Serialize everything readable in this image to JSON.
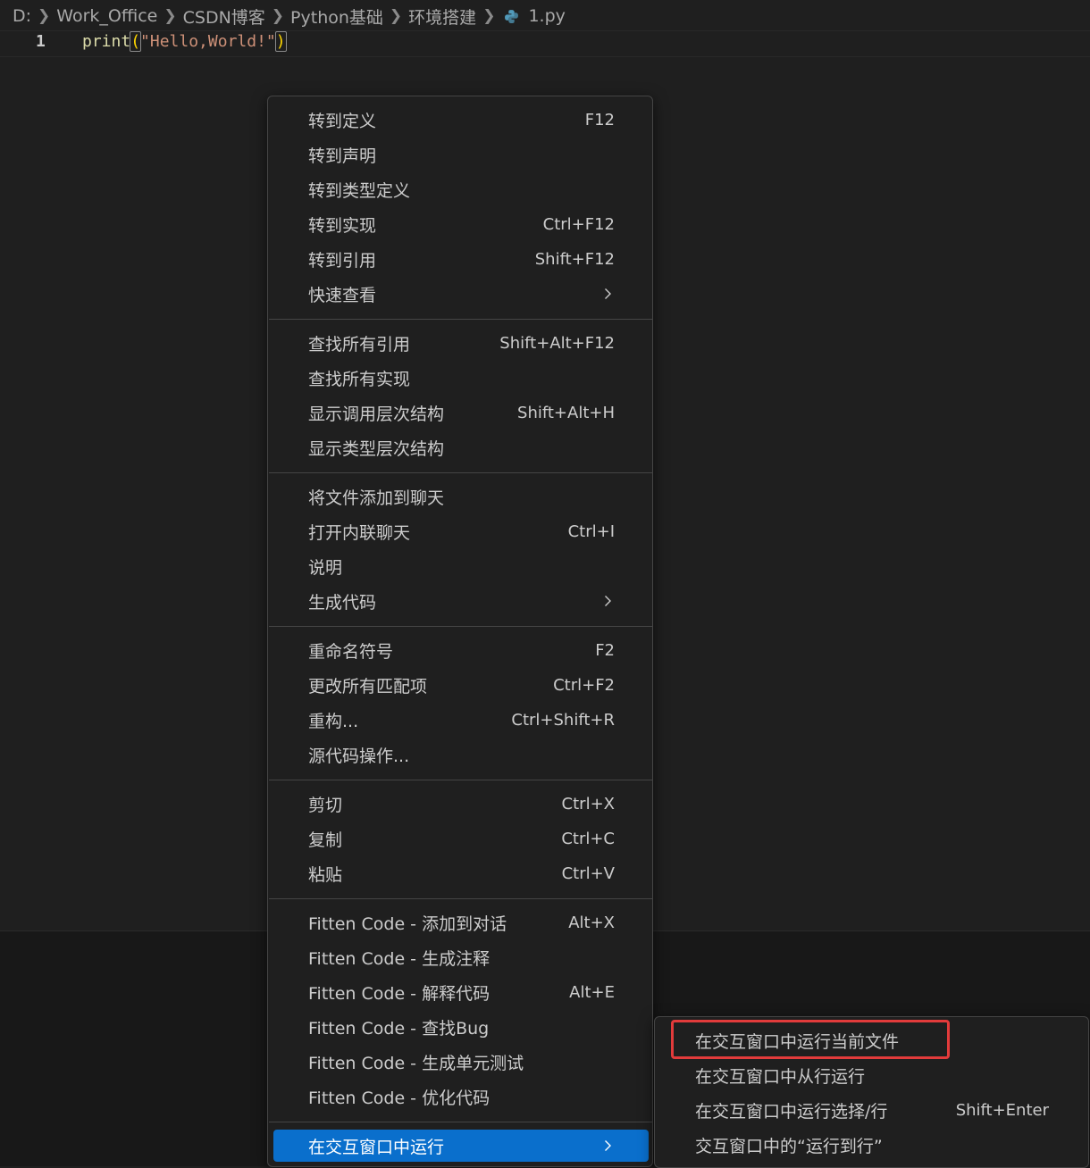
{
  "breadcrumb": {
    "segments": [
      "D:",
      "Work_Office",
      "CSDN博客",
      "Python基础",
      "环境搭建"
    ],
    "file": "1.py",
    "file_icon": "python-icon"
  },
  "editor": {
    "line_number": "1",
    "code": {
      "fn": "print",
      "open": "(",
      "str": "\"Hello,World!\"",
      "close": ")"
    }
  },
  "context_menu": {
    "groups": [
      [
        {
          "label": "转到定义",
          "shortcut": "F12"
        },
        {
          "label": "转到声明",
          "shortcut": ""
        },
        {
          "label": "转到类型定义",
          "shortcut": ""
        },
        {
          "label": "转到实现",
          "shortcut": "Ctrl+F12"
        },
        {
          "label": "转到引用",
          "shortcut": "Shift+F12"
        },
        {
          "label": "快速查看",
          "shortcut": "",
          "submenu": true
        }
      ],
      [
        {
          "label": "查找所有引用",
          "shortcut": "Shift+Alt+F12"
        },
        {
          "label": "查找所有实现",
          "shortcut": ""
        },
        {
          "label": "显示调用层次结构",
          "shortcut": "Shift+Alt+H"
        },
        {
          "label": "显示类型层次结构",
          "shortcut": ""
        }
      ],
      [
        {
          "label": "将文件添加到聊天",
          "shortcut": ""
        },
        {
          "label": "打开内联聊天",
          "shortcut": "Ctrl+I"
        },
        {
          "label": "说明",
          "shortcut": ""
        },
        {
          "label": "生成代码",
          "shortcut": "",
          "submenu": true
        }
      ],
      [
        {
          "label": "重命名符号",
          "shortcut": "F2"
        },
        {
          "label": "更改所有匹配项",
          "shortcut": "Ctrl+F2"
        },
        {
          "label": "重构...",
          "shortcut": "Ctrl+Shift+R"
        },
        {
          "label": "源代码操作...",
          "shortcut": ""
        }
      ],
      [
        {
          "label": "剪切",
          "shortcut": "Ctrl+X"
        },
        {
          "label": "复制",
          "shortcut": "Ctrl+C"
        },
        {
          "label": "粘贴",
          "shortcut": "Ctrl+V"
        }
      ],
      [
        {
          "label": "Fitten Code - 添加到对话",
          "shortcut": "Alt+X"
        },
        {
          "label": "Fitten Code - 生成注释",
          "shortcut": ""
        },
        {
          "label": "Fitten Code - 解释代码",
          "shortcut": "Alt+E"
        },
        {
          "label": "Fitten Code - 查找Bug",
          "shortcut": ""
        },
        {
          "label": "Fitten Code - 生成单元测试",
          "shortcut": ""
        },
        {
          "label": "Fitten Code - 优化代码",
          "shortcut": ""
        }
      ],
      [
        {
          "label": "在交互窗口中运行",
          "shortcut": "",
          "submenu": true,
          "active": true
        }
      ]
    ]
  },
  "submenu": {
    "items": [
      {
        "label": "在交互窗口中运行当前文件",
        "shortcut": "",
        "highlighted": true
      },
      {
        "label": "在交互窗口中从行运行",
        "shortcut": ""
      },
      {
        "label": "在交互窗口中运行选择/行",
        "shortcut": "Shift+Enter"
      },
      {
        "label": "交互窗口中的“运行到行”",
        "shortcut": ""
      }
    ],
    "highlight_color": "#e23b3b"
  },
  "colors": {
    "editor_bg": "#1f1f1f",
    "menu_bg": "#1f1f1f",
    "menu_border": "#454545",
    "active_item": "#0a6fcc",
    "text": "#cccccc"
  }
}
